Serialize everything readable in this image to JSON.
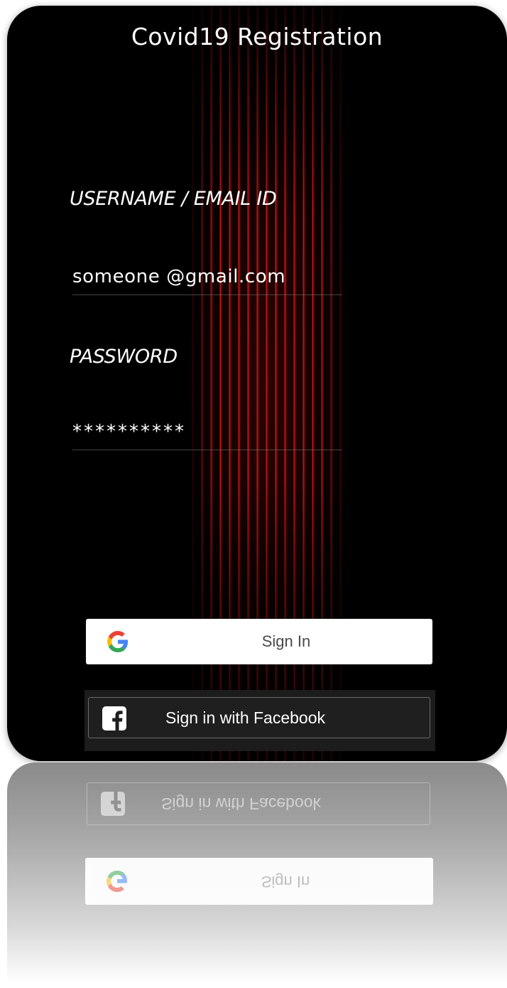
{
  "app": {
    "title": "Covid19 Registration"
  },
  "form": {
    "username_label": "USERNAME / EMAIL ID",
    "username_value": "someone @gmail.com",
    "password_label": "PASSWORD",
    "password_value": "**********"
  },
  "buttons": {
    "google_label": "Sign In",
    "google_icon": "google-g-icon",
    "facebook_label": "Sign in with Facebook",
    "facebook_icon": "facebook-f-icon"
  },
  "colors": {
    "background": "#000000",
    "stripe_accent": "#d62018",
    "google_button_bg": "#ffffff",
    "facebook_button_bg": "#1f1f1f"
  }
}
